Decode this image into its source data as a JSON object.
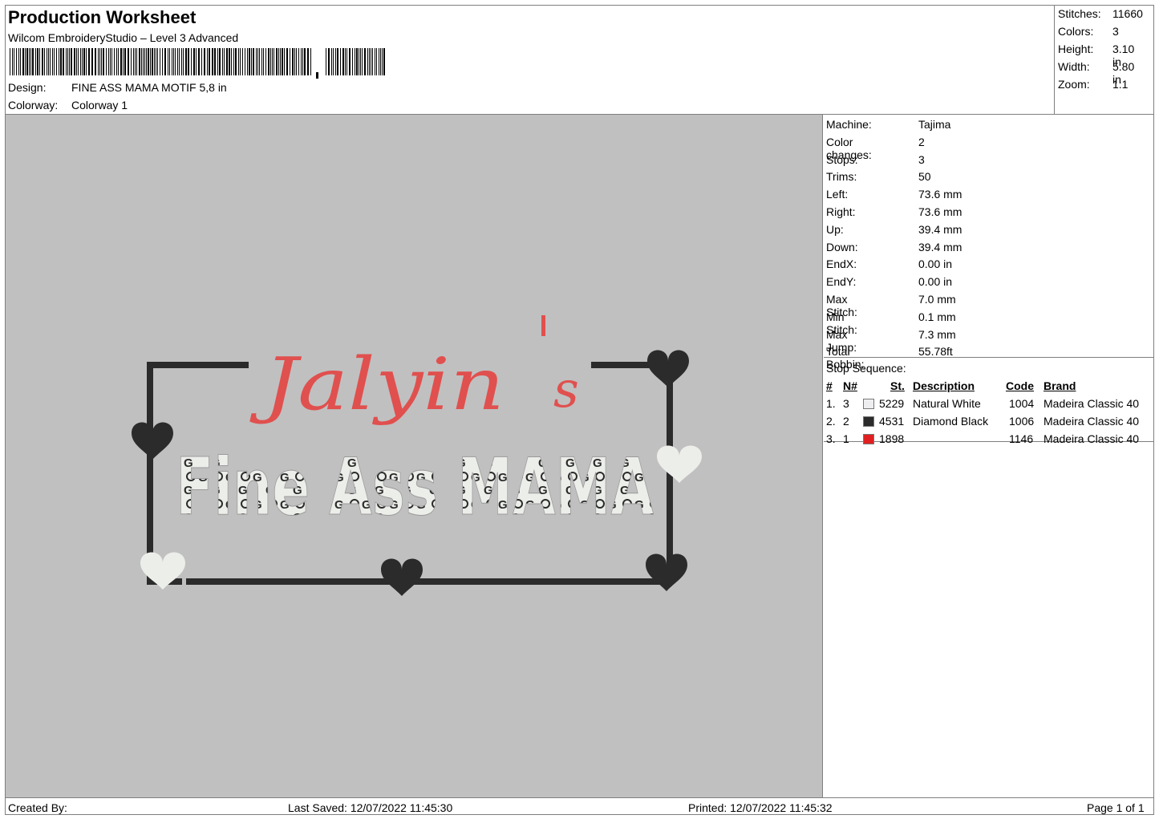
{
  "header": {
    "title": "Production Worksheet",
    "software": "Wilcom EmbroideryStudio – Level 3 Advanced",
    "design_label": "Design:",
    "design_value": "FINE ASS MAMA MOTIF 5,8 in",
    "colorway_label": "Colorway:",
    "colorway_value": "Colorway 1"
  },
  "summary": [
    {
      "label": "Stitches:",
      "value": "11660"
    },
    {
      "label": "Colors:",
      "value": "3"
    },
    {
      "label": "Height:",
      "value": "3.10 in"
    },
    {
      "label": "Width:",
      "value": "5.80 in"
    },
    {
      "label": "Zoom:",
      "value": "1:1"
    }
  ],
  "info": [
    {
      "label": "Machine:",
      "value": "Tajima"
    },
    {
      "label": "Color changes:",
      "value": "2"
    },
    {
      "label": "Stops:",
      "value": "3"
    },
    {
      "label": "Trims:",
      "value": "50"
    },
    {
      "label": "Left:",
      "value": "73.6 mm"
    },
    {
      "label": "Right:",
      "value": "73.6 mm"
    },
    {
      "label": "Up:",
      "value": "39.4 mm"
    },
    {
      "label": "Down:",
      "value": "39.4 mm"
    },
    {
      "label": "EndX:",
      "value": "0.00 in"
    },
    {
      "label": "EndY:",
      "value": "0.00 in"
    },
    {
      "label": "Max Stitch:",
      "value": "7.0 mm"
    },
    {
      "label": "Min Stitch:",
      "value": "0.1 mm"
    },
    {
      "label": "Max Jump:",
      "value": "7.3 mm"
    },
    {
      "label": "Total Bobbin:",
      "value": "55.78ft"
    }
  ],
  "stop_sequence": {
    "title": "Stop Sequence:",
    "headers": {
      "index": "#",
      "needle": "N#",
      "stitches": "St.",
      "description": "Description",
      "code": "Code",
      "brand": "Brand"
    },
    "rows": [
      {
        "index": "1.",
        "needle": "3",
        "color": "#eeeef0",
        "stitches": "5229",
        "description": "Natural White",
        "code": "1004",
        "brand": "Madeira Classic 40"
      },
      {
        "index": "2.",
        "needle": "2",
        "color": "#2b2b2b",
        "stitches": "4531",
        "description": "Diamond Black",
        "code": "1006",
        "brand": "Madeira Classic 40"
      },
      {
        "index": "3.",
        "needle": "1",
        "color": "#e02020",
        "stitches": "1898",
        "description": "",
        "code": "1146",
        "brand": "Madeira Classic 40"
      }
    ]
  },
  "design_preview": {
    "script_text": "Jalyin",
    "apostrophe_s": "s",
    "block_text": "Fine Ass MAMA",
    "colors": {
      "red": "#e0504e",
      "black": "#2b2b2b",
      "white": "#eceeea",
      "background": "#c0c0c0"
    }
  },
  "footer": {
    "created_by": "Created By:",
    "last_saved": "Last Saved: 12/07/2022 11:45:30",
    "printed": "Printed: 12/07/2022 11:45:32",
    "page": "Page 1 of 1"
  }
}
